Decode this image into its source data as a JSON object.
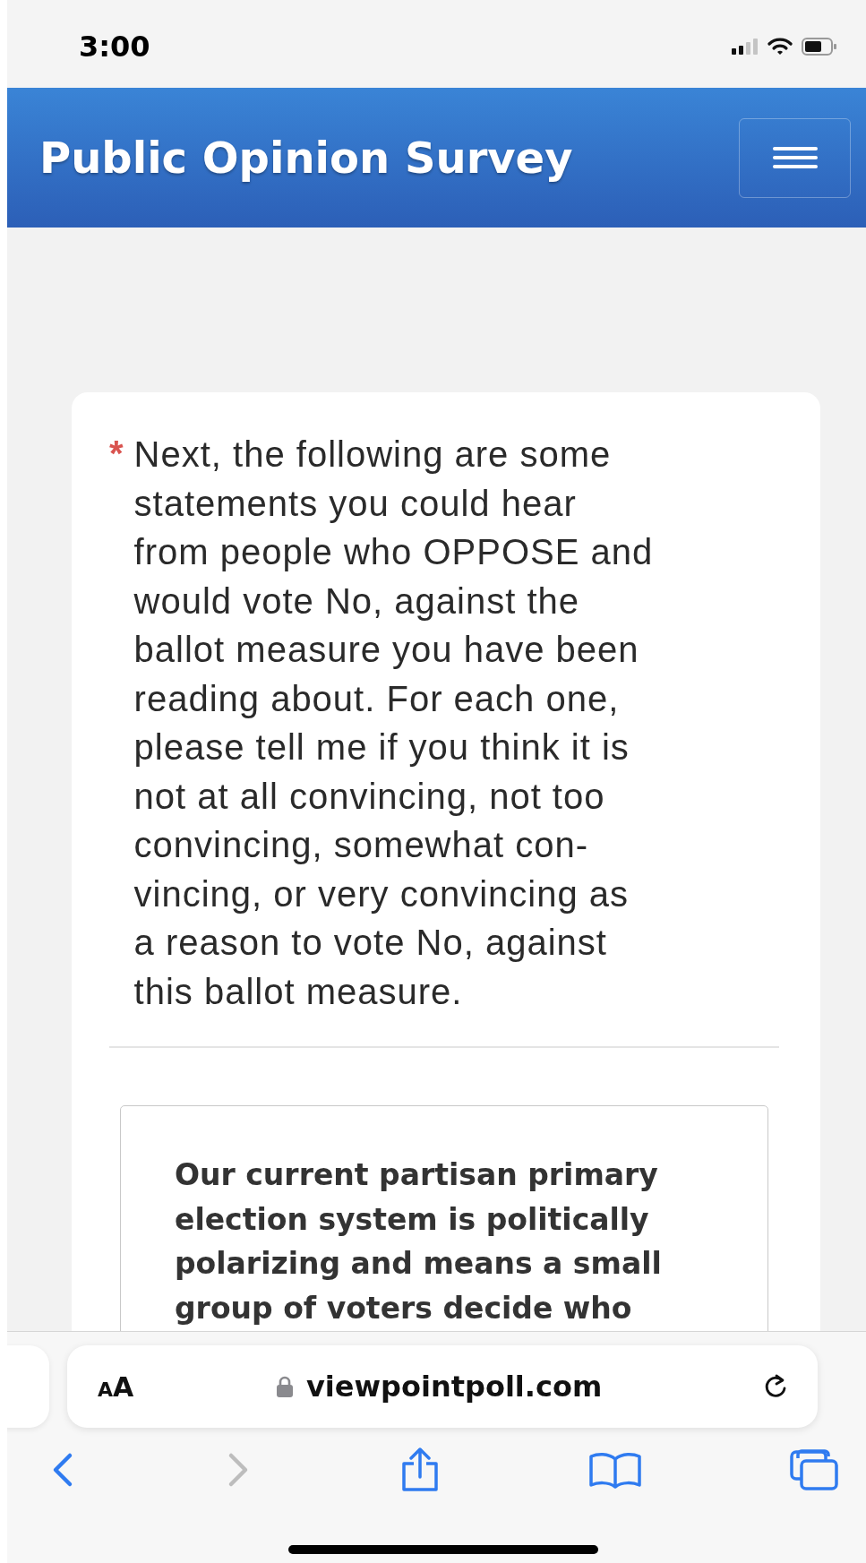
{
  "status_bar": {
    "time": "3:00"
  },
  "header": {
    "title": "Public Opinion Survey"
  },
  "question": {
    "required_mark": "*",
    "required": true,
    "lines": [
      "Next, the following are some",
      "statements you could hear",
      "from people who OPPOSE and",
      "would vote No, against the",
      "ballot measure you have been",
      "reading about. For each one,",
      "please tell me if you think it is",
      "not at all convincing, not too",
      "convincing, somewhat con-",
      "vincing, or very convincing as",
      "a reason to vote No, against",
      "this ballot measure."
    ],
    "statement_lines": [
      "Our current partisan primary",
      "election system is politically",
      "polarizing and means a small",
      "group of voters decide who"
    ]
  },
  "browser": {
    "text_size_label": "AA",
    "url": "viewpointpoll.com",
    "toolbar": [
      {
        "kind": "back",
        "disabled": false
      },
      {
        "kind": "forward",
        "disabled": true
      },
      {
        "kind": "share",
        "disabled": false
      },
      {
        "kind": "bookmarks",
        "disabled": false
      },
      {
        "kind": "tabs",
        "disabled": false
      }
    ]
  }
}
